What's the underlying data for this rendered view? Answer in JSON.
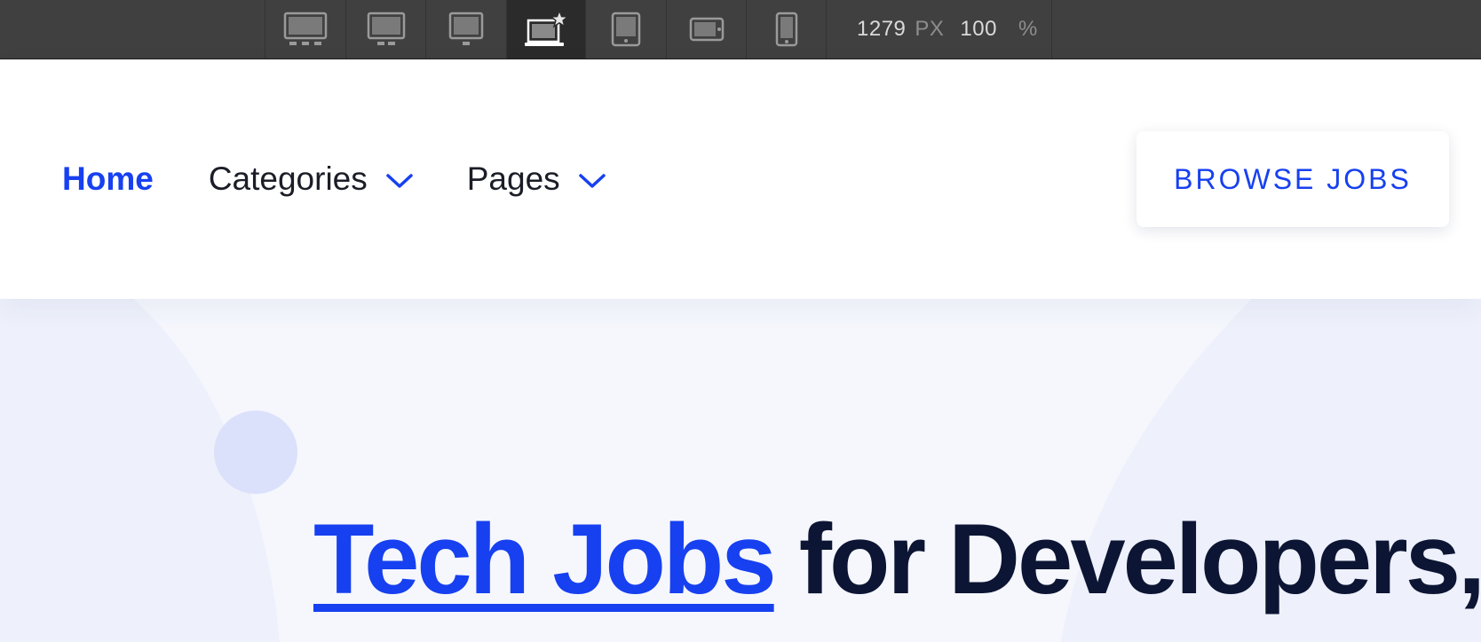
{
  "toolbar": {
    "breakpoints": [
      {
        "name": "desktop-xxl",
        "icon": "monitor-xxl-icon"
      },
      {
        "name": "desktop-xl",
        "icon": "monitor-xl-icon"
      },
      {
        "name": "desktop-large",
        "icon": "monitor-icon"
      },
      {
        "name": "desktop-base",
        "icon": "laptop-star-icon",
        "active": true
      },
      {
        "name": "tablet",
        "icon": "tablet-icon"
      },
      {
        "name": "mobile-landscape",
        "icon": "phone-landscape-icon"
      },
      {
        "name": "mobile-portrait",
        "icon": "phone-portrait-icon"
      }
    ],
    "width_value": "1279",
    "width_unit": "PX",
    "zoom_value": "100",
    "zoom_unit": "%"
  },
  "header": {
    "nav": [
      {
        "label": "Home",
        "active": true
      },
      {
        "label": "Categories",
        "has_dropdown": true
      },
      {
        "label": "Pages",
        "has_dropdown": true
      }
    ],
    "cta_label": "BROWSE JOBS"
  },
  "hero": {
    "title_accent": "Tech Jobs",
    "title_rest": " for Developers,"
  },
  "colors": {
    "accent": "#1740f0",
    "heading": "#0c1533",
    "toolbar_bg": "#404040",
    "hero_bg": "#f5f7fd"
  }
}
